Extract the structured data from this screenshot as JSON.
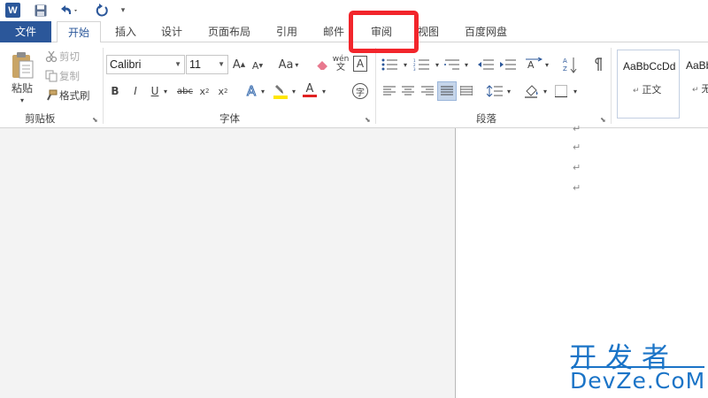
{
  "app_logo": "W",
  "quick_access": {
    "save_icon": "save-icon",
    "undo_icon": "undo-icon",
    "redo_icon": "redo-icon"
  },
  "tabs": [
    {
      "label": "文件"
    },
    {
      "label": "开始"
    },
    {
      "label": "插入"
    },
    {
      "label": "设计"
    },
    {
      "label": "页面布局"
    },
    {
      "label": "引用"
    },
    {
      "label": "邮件"
    },
    {
      "label": "审阅"
    },
    {
      "label": "视图"
    },
    {
      "label": "百度网盘"
    }
  ],
  "highlight_color": "#f2252b",
  "accent_color": "#2b579a",
  "clipboard": {
    "paste_label": "粘贴",
    "cut_label": "剪切",
    "copy_label": "复制",
    "format_painter_label": "格式刷",
    "group_label": "剪贴板"
  },
  "font": {
    "font_name": "Calibri",
    "font_size": "11",
    "grow_label": "A",
    "shrink_label": "A",
    "case_label": "Aa",
    "phonetic_label": "wén",
    "border_label": "A",
    "bold_label": "B",
    "italic_label": "I",
    "underline_label": "U",
    "strike_label": "abc",
    "sub_label": "x",
    "sup_label": "x",
    "sub_mark": "2",
    "sup_mark": "2",
    "effects_label": "A",
    "color_label": "A",
    "enclose_label": "字",
    "group_label": "字体"
  },
  "paragraph": {
    "group_label": "段落"
  },
  "styles": {
    "preview1": "AaBbCcDd",
    "name1": "正文",
    "preview2": "AaBb",
    "name2": "无"
  },
  "document": {
    "para_mark": "↵"
  },
  "watermark": {
    "line1": "开发者",
    "line2": "DevZe.CoM"
  }
}
